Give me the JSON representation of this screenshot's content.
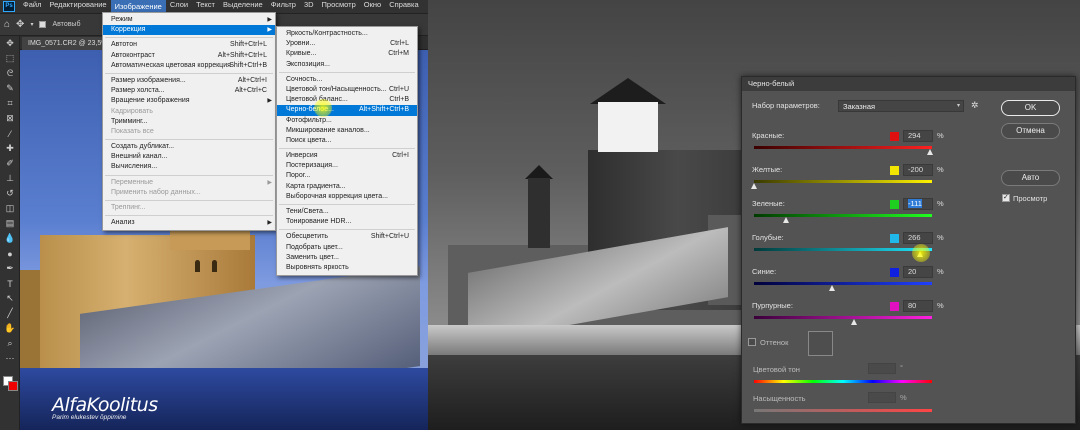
{
  "menubar": {
    "items": [
      "Файл",
      "Редактирование",
      "Изображение",
      "Слои",
      "Текст",
      "Выделение",
      "Фильтр",
      "3D",
      "Просмотр",
      "Окно",
      "Справка"
    ],
    "active_index": 2
  },
  "optionsbar": {
    "auto_select_label": "Автовыб"
  },
  "document": {
    "tab_label": "IMG_0571.CR2 @ 23,5% ("
  },
  "image_menu": {
    "items": [
      {
        "label": "Режим",
        "shortcut": "",
        "submenu": true,
        "disabled": false,
        "sep_before": false
      },
      {
        "label": "Коррекция",
        "shortcut": "",
        "submenu": true,
        "disabled": false,
        "highlighted": true,
        "sep_before": false
      },
      {
        "label": "Автотон",
        "shortcut": "Shift+Ctrl+L",
        "submenu": false,
        "disabled": false,
        "sep_before": true
      },
      {
        "label": "Автоконтраст",
        "shortcut": "Alt+Shift+Ctrl+L",
        "submenu": false,
        "disabled": false,
        "sep_before": false
      },
      {
        "label": "Автоматическая цветовая коррекция",
        "shortcut": "Shift+Ctrl+B",
        "submenu": false,
        "disabled": false,
        "sep_before": false
      },
      {
        "label": "Размер изображения...",
        "shortcut": "Alt+Ctrl+I",
        "submenu": false,
        "disabled": false,
        "sep_before": true
      },
      {
        "label": "Размер холста...",
        "shortcut": "Alt+Ctrl+C",
        "submenu": false,
        "disabled": false,
        "sep_before": false
      },
      {
        "label": "Вращение изображения",
        "shortcut": "",
        "submenu": true,
        "disabled": false,
        "sep_before": false
      },
      {
        "label": "Кадрировать",
        "shortcut": "",
        "submenu": false,
        "disabled": true,
        "sep_before": false
      },
      {
        "label": "Тримминг...",
        "shortcut": "",
        "submenu": false,
        "disabled": false,
        "sep_before": false
      },
      {
        "label": "Показать все",
        "shortcut": "",
        "submenu": false,
        "disabled": true,
        "sep_before": false
      },
      {
        "label": "Создать дубликат...",
        "shortcut": "",
        "submenu": false,
        "disabled": false,
        "sep_before": true
      },
      {
        "label": "Внешний канал...",
        "shortcut": "",
        "submenu": false,
        "disabled": false,
        "sep_before": false
      },
      {
        "label": "Вычисления...",
        "shortcut": "",
        "submenu": false,
        "disabled": false,
        "sep_before": false
      },
      {
        "label": "Переменные",
        "shortcut": "",
        "submenu": true,
        "disabled": true,
        "sep_before": true
      },
      {
        "label": "Применить набор данных...",
        "shortcut": "",
        "submenu": false,
        "disabled": true,
        "sep_before": false
      },
      {
        "label": "Треппинг...",
        "shortcut": "",
        "submenu": false,
        "disabled": true,
        "sep_before": true
      },
      {
        "label": "Анализ",
        "shortcut": "",
        "submenu": true,
        "disabled": false,
        "sep_before": true
      }
    ]
  },
  "adjust_menu": {
    "items": [
      {
        "label": "Яркость/Контрастность...",
        "shortcut": "",
        "sep_before": false
      },
      {
        "label": "Уровни...",
        "shortcut": "Ctrl+L",
        "sep_before": false
      },
      {
        "label": "Кривые...",
        "shortcut": "Ctrl+M",
        "sep_before": false
      },
      {
        "label": "Экспозиция...",
        "shortcut": "",
        "sep_before": false
      },
      {
        "label": "Сочность...",
        "shortcut": "",
        "sep_before": true
      },
      {
        "label": "Цветовой тон/Насыщенность...",
        "shortcut": "Ctrl+U",
        "sep_before": false
      },
      {
        "label": "Цветовой баланс...",
        "shortcut": "Ctrl+B",
        "sep_before": false
      },
      {
        "label": "Черно-белое...",
        "shortcut": "Alt+Shift+Ctrl+B",
        "highlighted": true,
        "sep_before": false
      },
      {
        "label": "Фотофильтр...",
        "shortcut": "",
        "sep_before": false
      },
      {
        "label": "Микширование каналов...",
        "shortcut": "",
        "sep_before": false
      },
      {
        "label": "Поиск цвета...",
        "shortcut": "",
        "sep_before": false
      },
      {
        "label": "Инверсия",
        "shortcut": "Ctrl+I",
        "sep_before": true
      },
      {
        "label": "Постеризация...",
        "shortcut": "",
        "sep_before": false
      },
      {
        "label": "Порог...",
        "shortcut": "",
        "sep_before": false
      },
      {
        "label": "Карта градиента...",
        "shortcut": "",
        "sep_before": false
      },
      {
        "label": "Выборочная коррекция цвета...",
        "shortcut": "",
        "sep_before": false
      },
      {
        "label": "Тени/Света...",
        "shortcut": "",
        "sep_before": true
      },
      {
        "label": "Тонирование HDR...",
        "shortcut": "",
        "sep_before": false
      },
      {
        "label": "Обесцветить",
        "shortcut": "Shift+Ctrl+U",
        "sep_before": true
      },
      {
        "label": "Подобрать цвет...",
        "shortcut": "",
        "sep_before": false
      },
      {
        "label": "Заменить цвет...",
        "shortcut": "",
        "sep_before": false
      },
      {
        "label": "Выровнять яркость",
        "shortcut": "",
        "sep_before": false
      }
    ]
  },
  "dialog": {
    "title": "Черно-белый",
    "preset_label": "Набор параметров:",
    "preset_value": "Заказная",
    "ok_label": "OK",
    "cancel_label": "Отмена",
    "auto_label": "Авто",
    "preview_label": "Просмотр",
    "preview_checked": true,
    "percent_sign": "%",
    "sliders": [
      {
        "label": "Красные:",
        "value": "294",
        "num": 294,
        "swatch": "#e01010",
        "gradient": "linear-gradient(90deg,#3a0000,#ff2020)",
        "selected": false
      },
      {
        "label": "Желтые:",
        "value": "-200",
        "num": -200,
        "swatch": "#f2e600",
        "gradient": "linear-gradient(90deg,#3a3a00,#fff200)",
        "selected": false
      },
      {
        "label": "Зеленые:",
        "value": "-111",
        "num": -111,
        "swatch": "#20d020",
        "gradient": "linear-gradient(90deg,#003a00,#20ff20)",
        "selected": true
      },
      {
        "label": "Голубые:",
        "value": "266",
        "num": 266,
        "swatch": "#20b8e8",
        "gradient": "linear-gradient(90deg,#003a3a,#20e8ff)",
        "selected": false
      },
      {
        "label": "Синие:",
        "value": "20",
        "num": 20,
        "swatch": "#1020e0",
        "gradient": "linear-gradient(90deg,#00003a,#2040ff)",
        "selected": false
      },
      {
        "label": "Пурпурные:",
        "value": "80",
        "num": 80,
        "swatch": "#e010c0",
        "gradient": "linear-gradient(90deg,#3a003a,#ff20e0)",
        "selected": false
      }
    ],
    "tint_label": "Оттенок",
    "hue_label": "Цветовой тон",
    "hue_unit": "°",
    "saturation_label": "Насыщенность",
    "saturation_unit": "%"
  },
  "watermark": {
    "logo": "AlfaKoolitus",
    "tagline": "Parim elukestev õppimine"
  },
  "colors": {
    "menu_highlight": "#0078d7",
    "foreground": "#ffffff",
    "background": "#e00000"
  }
}
